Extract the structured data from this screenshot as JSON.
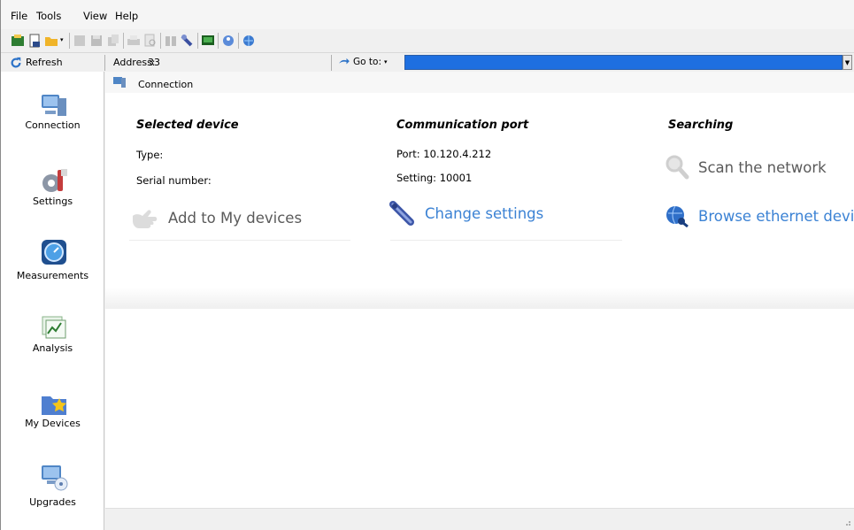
{
  "menu": {
    "file": "File",
    "tools": "Tools",
    "view": "View",
    "help": "Help"
  },
  "address_bar": {
    "refresh_label": "Refresh",
    "address_label": "Address:",
    "address_value": "33",
    "goto_label": "Go to:",
    "goto_value": ""
  },
  "nav": {
    "items": [
      {
        "label": "Connection",
        "icon": "computer-network-icon"
      },
      {
        "label": "Settings",
        "icon": "gear-wrench-icon"
      },
      {
        "label": "Measurements",
        "icon": "gauge-icon"
      },
      {
        "label": "Analysis",
        "icon": "chart-icon"
      },
      {
        "label": "My Devices",
        "icon": "folder-star-icon"
      },
      {
        "label": "Upgrades",
        "icon": "computer-disc-icon"
      }
    ]
  },
  "page": {
    "breadcrumb": "Connection",
    "selected_device": {
      "heading": "Selected device",
      "type_label": "Type:",
      "serial_label": "Serial number:",
      "add_action": "Add to My devices"
    },
    "communication_port": {
      "heading": "Communication port",
      "port": "Port: 10.120.4.212",
      "setting": "Setting: 10001",
      "change_action": "Change settings"
    },
    "searching": {
      "heading": "Searching",
      "scan_action": "Scan the network",
      "browse_action": "Browse ethernet devices"
    }
  },
  "colors": {
    "accent": "#1e6fe0",
    "link": "#3b82d4",
    "disabled_text": "#5a5a5a"
  }
}
